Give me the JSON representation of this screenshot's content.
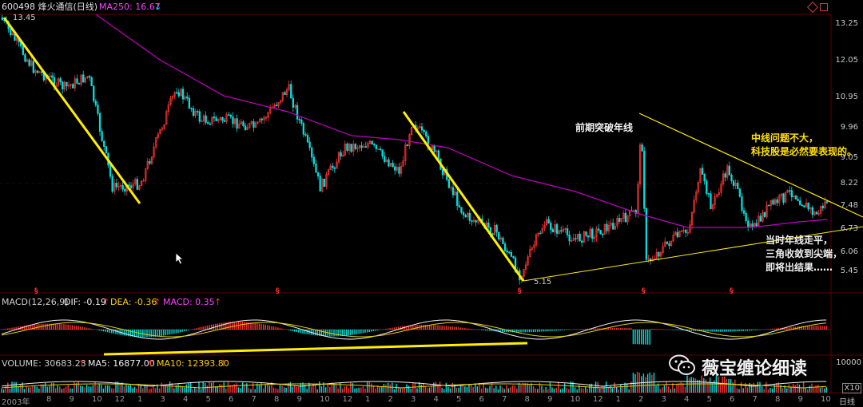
{
  "header": {
    "stock_title": "600498 烽火通信(日线)",
    "ma250_label": "MA250: 16.67",
    "ma250_arrow": "↓"
  },
  "price_axis": [
    "13.25",
    "12.05",
    "10.95",
    "9.96",
    "9.05",
    "8.22",
    "7.48",
    "6.73",
    "6.06",
    "5.45"
  ],
  "markers": {
    "high": "13.45",
    "low": "5.15"
  },
  "annotations": {
    "breakout": "前期突破年线",
    "outlook_line1": "中线问题不大，",
    "outlook_line2": "科技股是必然要表现的。",
    "status_line1": "当时年线走平，",
    "status_line2": "三角收敛到尖端，",
    "status_line3": "即将出结果……"
  },
  "macd": {
    "label": "MACD(12,26,9)",
    "dif": "DIF: -0.19",
    "dea": "DEA: -0.36",
    "macd": "MACD: 0.35",
    "arrow": "↑"
  },
  "volume": {
    "label": "VOLUME: 30683.23",
    "ma5": "MA5: 16877.00",
    "ma10": "MA10: 12393.80",
    "arrow": "↑",
    "axis_top": "10000",
    "multiplier": "X10"
  },
  "time_axis": {
    "year": "2003年",
    "months": [
      "8",
      "9",
      "10",
      "12",
      "1",
      "3",
      "4",
      "5",
      "6",
      "7",
      "8",
      "9",
      "10",
      "12",
      "1",
      "2",
      "3",
      "4",
      "5",
      "6",
      "7",
      "8",
      "9",
      "10",
      "12",
      "1",
      "2",
      "3",
      "4",
      "5",
      "6",
      "7",
      "8",
      "9",
      "10"
    ],
    "period": "日线"
  },
  "watermark": "薇宝缠论细读",
  "colors": {
    "up": "#ff3232",
    "down": "#00e0e0",
    "ma250": "#c000c0",
    "trend": "#ffee00",
    "grid": "#600000"
  }
}
